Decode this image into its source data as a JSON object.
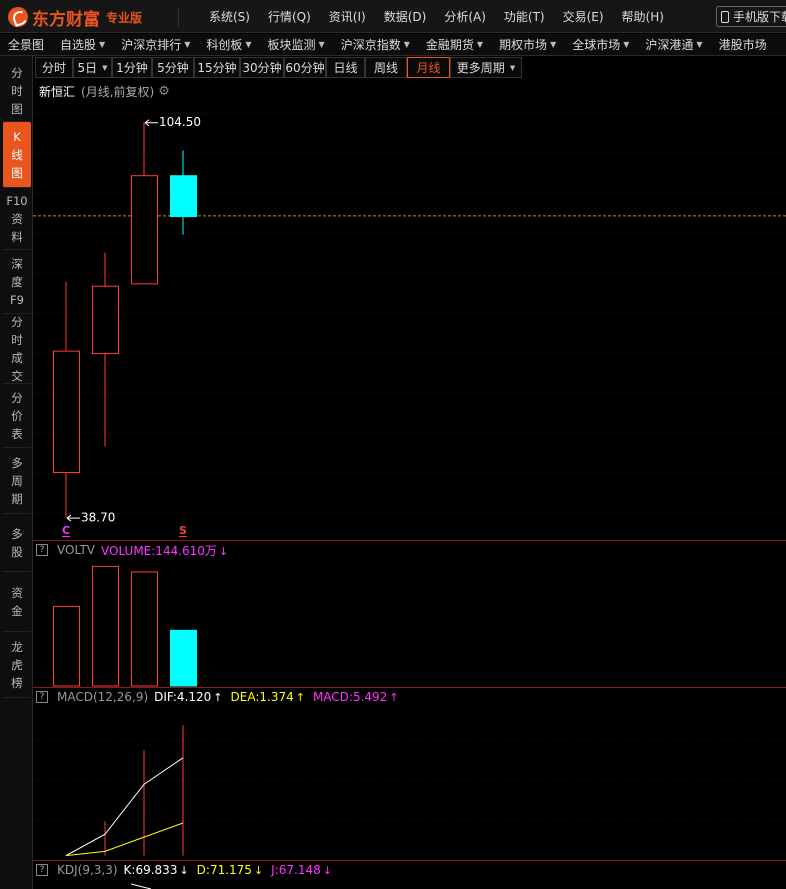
{
  "app": {
    "logo_text": "东方财富",
    "edition": "专业版",
    "menu": [
      "系统(S)",
      "行情(Q)",
      "资讯(I)",
      "数据(D)",
      "分析(A)",
      "功能(T)",
      "交易(E)",
      "帮助(H)"
    ],
    "mobile_button": "手机版下载"
  },
  "navbar": [
    {
      "label": "全景图",
      "dropdown": false
    },
    {
      "label": "自选股",
      "dropdown": true
    },
    {
      "label": "沪深京排行",
      "dropdown": true
    },
    {
      "label": "科创板",
      "dropdown": true
    },
    {
      "label": "板块监测",
      "dropdown": true
    },
    {
      "label": "沪深京指数",
      "dropdown": true
    },
    {
      "label": "金融期货",
      "dropdown": true
    },
    {
      "label": "期权市场",
      "dropdown": true
    },
    {
      "label": "全球市场",
      "dropdown": true
    },
    {
      "label": "沪深港通",
      "dropdown": true
    },
    {
      "label": "港股市场",
      "dropdown": false
    }
  ],
  "sidebar": [
    {
      "lines": [
        "分",
        "时",
        "图"
      ],
      "active": false
    },
    {
      "lines": [
        "K",
        "线",
        "图"
      ],
      "active": true
    },
    {
      "lines": [
        "F10",
        "资",
        "料"
      ],
      "active": false
    },
    {
      "lines": [
        "深",
        "度",
        "F9"
      ],
      "active": false
    },
    {
      "lines": [
        "分",
        "时",
        "成",
        "交"
      ],
      "active": false
    },
    {
      "lines": [
        "分",
        "价",
        "表"
      ],
      "active": false
    },
    {
      "lines": [
        "多",
        "周",
        "期"
      ],
      "active": false
    },
    {
      "lines": [
        "多",
        "股"
      ],
      "active": false
    },
    {
      "lines": [
        "资",
        "金"
      ],
      "active": false
    },
    {
      "lines": [
        "龙",
        "虎",
        "榜"
      ],
      "active": false
    }
  ],
  "periods": [
    {
      "label": "分时",
      "dropdown": false,
      "active": false
    },
    {
      "label": "5日",
      "dropdown": true,
      "active": false
    },
    {
      "label": "1分钟",
      "dropdown": false,
      "active": false
    },
    {
      "label": "5分钟",
      "dropdown": false,
      "active": false
    },
    {
      "label": "15分钟",
      "dropdown": false,
      "active": false
    },
    {
      "label": "30分钟",
      "dropdown": false,
      "active": false
    },
    {
      "label": "60分钟",
      "dropdown": false,
      "active": false
    },
    {
      "label": "日线",
      "dropdown": false,
      "active": false
    },
    {
      "label": "周线",
      "dropdown": false,
      "active": false
    },
    {
      "label": "月线",
      "dropdown": false,
      "active": true
    },
    {
      "label": "更多周期",
      "dropdown": true,
      "active": false
    }
  ],
  "chart_header": {
    "name": "新恒汇",
    "subtitle": "(月线,前复权)"
  },
  "colors": {
    "up": "#ff3b3b",
    "down": "#00ffff",
    "accent": "#e8551f",
    "magenta": "#ff33ff",
    "yellow": "#ffff00",
    "white": "#ffffff"
  },
  "chart_data": [
    {
      "type": "candlestick",
      "candles": [
        {
          "open": 46.2,
          "high": 78.0,
          "low": 38.7,
          "close": 66.4,
          "dir": "up"
        },
        {
          "open": 66.0,
          "high": 82.8,
          "low": 50.5,
          "close": 77.2,
          "dir": "up"
        },
        {
          "open": 77.6,
          "high": 104.5,
          "low": 77.6,
          "close": 95.6,
          "dir": "up"
        },
        {
          "open": 95.6,
          "high": 99.8,
          "low": 85.8,
          "close": 88.8,
          "dir": "down"
        }
      ],
      "ylim": [
        35.3,
        108.2
      ],
      "reference_price": 89.0,
      "high_label": "104.50",
      "low_label": "38.70",
      "markers": [
        {
          "candle": 0,
          "label": "C"
        },
        {
          "candle": 3,
          "label": "S"
        }
      ]
    },
    {
      "type": "bar",
      "indicator": "VOLTV",
      "value_label": "VOLUME:144.610万",
      "values": [
        1.43,
        2.15,
        2.05,
        1.0
      ],
      "directions": [
        "up",
        "up",
        "up",
        "down"
      ]
    },
    {
      "type": "line",
      "indicator": "MACD(12,26,9)",
      "dif_label": "DIF:4.120",
      "dea_label": "DEA:1.374",
      "macd_label": "MACD:5.492",
      "dif": [
        0.0,
        0.9,
        3.0,
        4.12
      ],
      "dea": [
        0.0,
        0.18,
        0.78,
        1.374
      ],
      "macd": [
        0.0,
        1.44,
        4.44,
        5.492
      ],
      "ylim": [
        -0.1,
        6.3
      ]
    },
    {
      "type": "line",
      "indicator": "KDJ(9,3,3)",
      "k_label": "K:69.833",
      "d_label": "D:71.175",
      "j_label": "J:67.148"
    }
  ]
}
